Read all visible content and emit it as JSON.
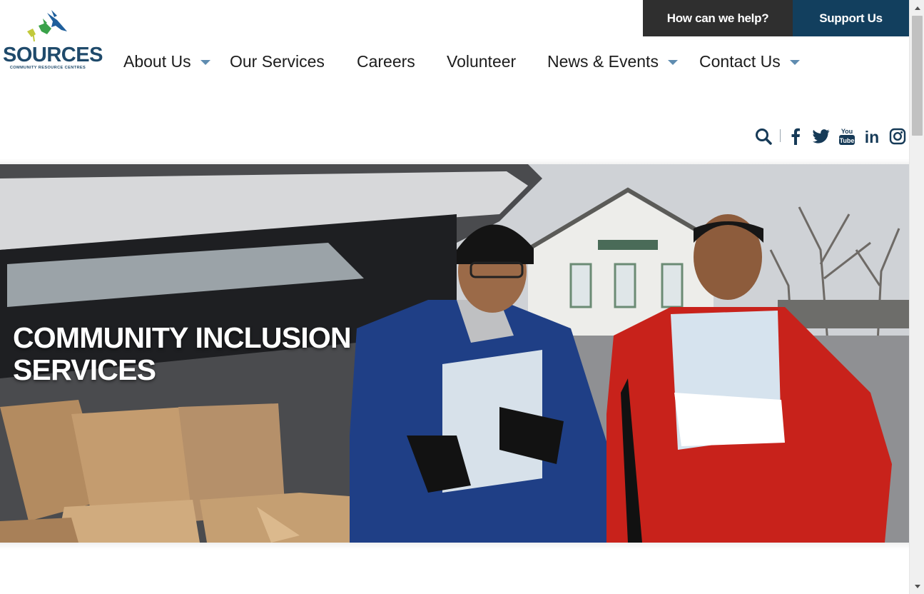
{
  "logo": {
    "wordmark": "SOURCES",
    "tagline": "COMMUNITY RESOURCE CENTRES"
  },
  "top_actions": {
    "help_label": "How can we help?",
    "support_label": "Support Us"
  },
  "nav": {
    "items": [
      {
        "label": "About Us",
        "has_dropdown": true
      },
      {
        "label": "Our Services",
        "has_dropdown": false
      },
      {
        "label": "Careers",
        "has_dropdown": false
      },
      {
        "label": "Volunteer",
        "has_dropdown": false
      },
      {
        "label": "News & Events",
        "has_dropdown": true
      },
      {
        "label": "Contact Us",
        "has_dropdown": true
      }
    ]
  },
  "social": {
    "icons": [
      "search-icon",
      "facebook-icon",
      "twitter-icon",
      "youtube-icon",
      "linkedin-icon",
      "instagram-icon"
    ],
    "youtube_text_top": "You",
    "youtube_text_bottom": "Tube",
    "linkedin_text": "in"
  },
  "hero": {
    "title_line1": "COMMUNITY INCLUSION",
    "title_line2": "SERVICES"
  },
  "colors": {
    "brand_navy": "#123f5e",
    "dark_button": "#2f2f2f",
    "caret_blue": "#5f8cb0",
    "icon_navy": "#163a57"
  }
}
